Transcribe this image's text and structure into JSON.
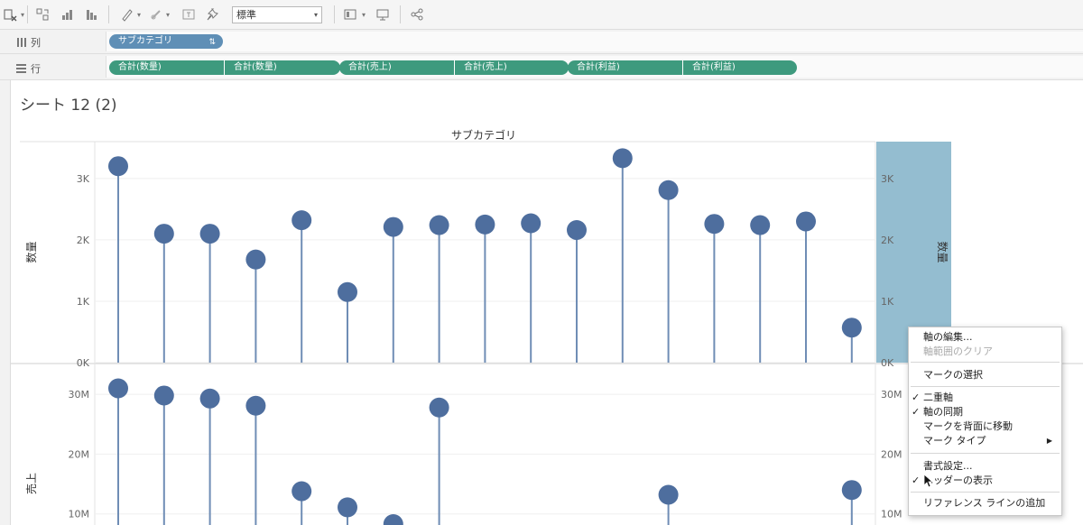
{
  "toolbar": {
    "mark_type_value": "標準",
    "dropdown_glyph": "▾"
  },
  "shelves": {
    "columns_label": "列",
    "rows_label": "行",
    "column_pill": "サブカテゴリ",
    "row_pills": [
      "合計(数量)",
      "合計(数量)",
      "合計(売上)",
      "合計(売上)",
      "合計(利益)",
      "合計(利益)"
    ]
  },
  "sheet": {
    "title": "シート 12 (2)",
    "column_header": "サブカテゴリ"
  },
  "chart_data": {
    "type": "scatter",
    "categories_count": 17,
    "panes": [
      {
        "axis_title": "数量",
        "right_axis_title": "数量",
        "ticks": [
          "0K",
          "1K",
          "2K",
          "3K"
        ],
        "tick_values": [
          0,
          1000,
          2000,
          3000
        ],
        "ylim": [
          0,
          3600
        ],
        "values": [
          3200,
          2100,
          2100,
          1680,
          2320,
          1150,
          2210,
          2240,
          2250,
          2270,
          2160,
          3330,
          2810,
          2260,
          2240,
          2300,
          570
        ]
      },
      {
        "axis_title": "売上",
        "right_axis_title": "",
        "ticks": [
          "10M",
          "20M",
          "30M"
        ],
        "tick_values": [
          10000000,
          20000000,
          30000000
        ],
        "ylim": [
          0,
          35000000
        ],
        "values": [
          31000000,
          29800000,
          29300000,
          28100000,
          13800000,
          11100000,
          8300000,
          27800000,
          null,
          null,
          null,
          null,
          13200000,
          null,
          null,
          null,
          14000000
        ]
      }
    ],
    "colors": {
      "mark": "#4e6e9e",
      "stem": "#6f8db5",
      "highlight": "#94bdd0"
    },
    "grid": true,
    "legend": "none"
  },
  "context_menu": {
    "items": [
      {
        "label": "軸の編集...",
        "disabled": false,
        "checked": false,
        "submenu": false
      },
      {
        "label": "軸範囲のクリア",
        "disabled": true,
        "checked": false,
        "submenu": false
      },
      {
        "label": "マークの選択",
        "disabled": false,
        "checked": false,
        "submenu": false
      },
      {
        "label": "二重軸",
        "disabled": false,
        "checked": true,
        "submenu": false
      },
      {
        "label": "軸の同期",
        "disabled": false,
        "checked": true,
        "submenu": false
      },
      {
        "label": "マークを背面に移動",
        "disabled": false,
        "checked": false,
        "submenu": false
      },
      {
        "label": "マーク タイプ",
        "disabled": false,
        "checked": false,
        "submenu": true
      },
      {
        "label": "書式設定...",
        "disabled": false,
        "checked": false,
        "submenu": false
      },
      {
        "label": "ヘッダーの表示",
        "disabled": false,
        "checked": true,
        "submenu": false
      },
      {
        "label": "リファレンス ラインの追加",
        "disabled": false,
        "checked": false,
        "submenu": false
      }
    ],
    "check_glyph": "✓",
    "submenu_glyph": "▶"
  }
}
